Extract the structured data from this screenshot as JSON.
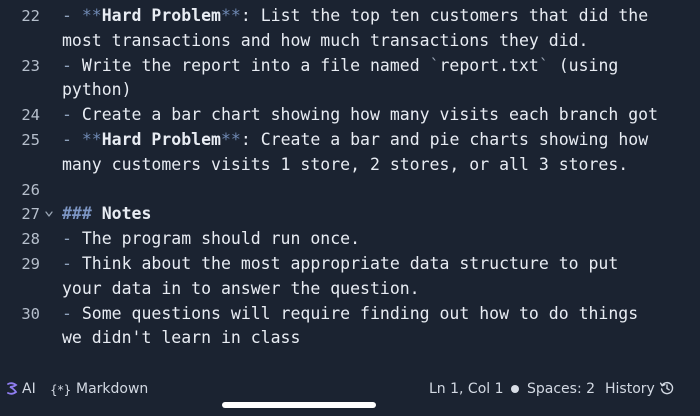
{
  "editor": {
    "lines": [
      {
        "num": "22",
        "segments": [
          {
            "text": "- ",
            "cls": "dash"
          },
          {
            "text": "**",
            "cls": "star"
          },
          {
            "text": "Hard Problem",
            "cls": "bold"
          },
          {
            "text": "**",
            "cls": "star"
          },
          {
            "text": ": List the top ten customers that did the",
            "cls": ""
          }
        ]
      },
      {
        "num": "",
        "segments": [
          {
            "text": "most transactions and how much transactions they did.",
            "cls": ""
          }
        ]
      },
      {
        "num": "23",
        "segments": [
          {
            "text": "- ",
            "cls": "dash"
          },
          {
            "text": "Write the report into a file named ",
            "cls": ""
          },
          {
            "text": "`",
            "cls": "tick"
          },
          {
            "text": "report.txt",
            "cls": ""
          },
          {
            "text": "`",
            "cls": "tick"
          },
          {
            "text": " (using",
            "cls": ""
          }
        ]
      },
      {
        "num": "",
        "segments": [
          {
            "text": "python)",
            "cls": ""
          }
        ]
      },
      {
        "num": "24",
        "segments": [
          {
            "text": "- ",
            "cls": "dash"
          },
          {
            "text": "Create a bar chart showing how many visits each branch got",
            "cls": ""
          }
        ]
      },
      {
        "num": "25",
        "segments": [
          {
            "text": "- ",
            "cls": "dash"
          },
          {
            "text": "**",
            "cls": "star"
          },
          {
            "text": "Hard Problem",
            "cls": "bold"
          },
          {
            "text": "**",
            "cls": "star"
          },
          {
            "text": ": Create a bar and pie charts showing how",
            "cls": ""
          }
        ]
      },
      {
        "num": "",
        "segments": [
          {
            "text": "many customers visits 1 store, 2 stores, or all 3 stores.",
            "cls": ""
          }
        ]
      },
      {
        "num": "26",
        "segments": []
      },
      {
        "num": "27",
        "fold": true,
        "segments": [
          {
            "text": "### ",
            "cls": "hash"
          },
          {
            "text": "Notes",
            "cls": "bold"
          }
        ]
      },
      {
        "num": "28",
        "segments": [
          {
            "text": "- ",
            "cls": "dash"
          },
          {
            "text": "The program should run once.",
            "cls": ""
          }
        ]
      },
      {
        "num": "29",
        "segments": [
          {
            "text": "- ",
            "cls": "dash"
          },
          {
            "text": "Think about the most appropriate data structure to put",
            "cls": ""
          }
        ]
      },
      {
        "num": "",
        "segments": [
          {
            "text": "your data in to answer the question.",
            "cls": ""
          }
        ]
      },
      {
        "num": "30",
        "segments": [
          {
            "text": "- ",
            "cls": "dash"
          },
          {
            "text": "Some questions will require finding out how to do things",
            "cls": ""
          }
        ]
      },
      {
        "num": "",
        "segments": [
          {
            "text": "we didn't learn in class",
            "cls": ""
          }
        ]
      }
    ]
  },
  "statusbar": {
    "ai_icon": "sparkle-icon",
    "ai_label": "AI",
    "language_icon": "braces-icon",
    "language_icon_text": "{*}",
    "language_label": "Markdown",
    "cursor_position": "Ln 1, Col 1",
    "spaces_label": "Spaces: 2",
    "history_label": "History",
    "history_icon": "history-icon"
  },
  "colors": {
    "background": "#1b2331",
    "text": "#e8ecf3",
    "line_number": "#b6bfcc",
    "markdown_syntax": "#6f89b3"
  }
}
